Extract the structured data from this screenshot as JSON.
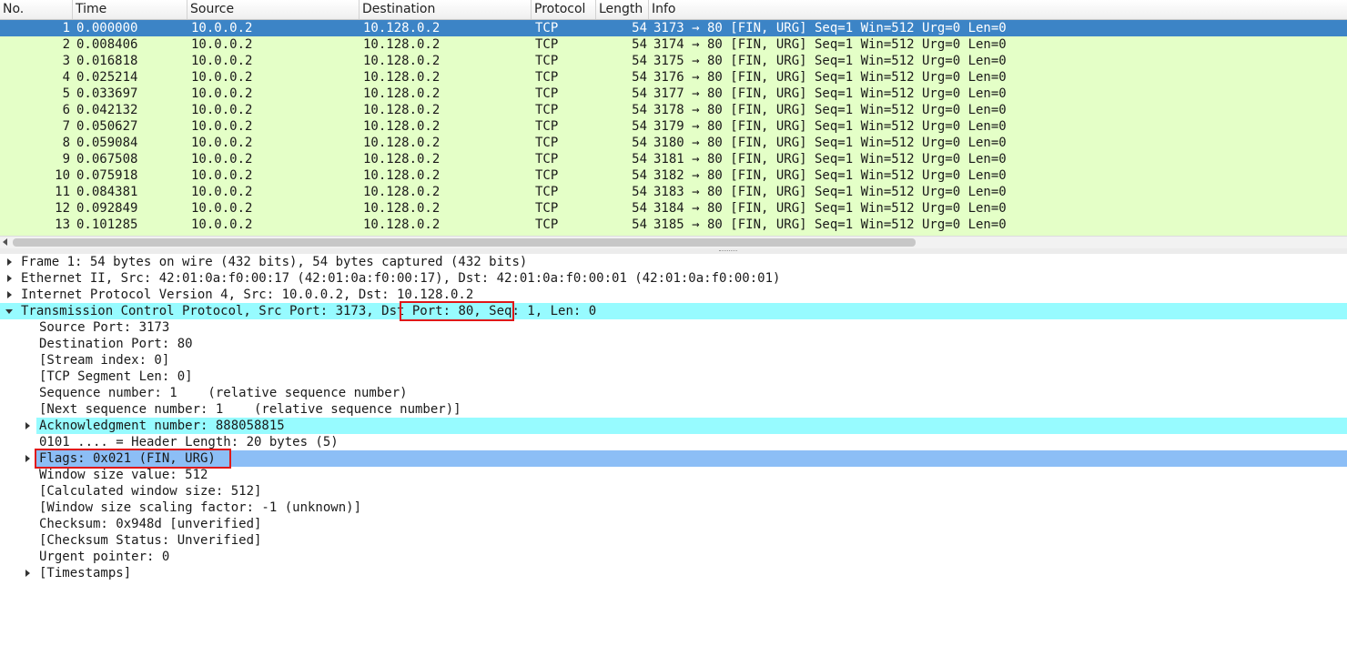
{
  "packet_list": {
    "columns": [
      "No.",
      "Time",
      "Source",
      "Destination",
      "Protocol",
      "Length",
      "Info"
    ],
    "rows": [
      {
        "no": "1",
        "time": "0.000000",
        "source": "10.0.0.2",
        "destination": "10.128.0.2",
        "protocol": "TCP",
        "length": "54",
        "info": "3173 → 80 [FIN, URG] Seq=1 Win=512 Urg=0 Len=0"
      },
      {
        "no": "2",
        "time": "0.008406",
        "source": "10.0.0.2",
        "destination": "10.128.0.2",
        "protocol": "TCP",
        "length": "54",
        "info": "3174 → 80 [FIN, URG] Seq=1 Win=512 Urg=0 Len=0"
      },
      {
        "no": "3",
        "time": "0.016818",
        "source": "10.0.0.2",
        "destination": "10.128.0.2",
        "protocol": "TCP",
        "length": "54",
        "info": "3175 → 80 [FIN, URG] Seq=1 Win=512 Urg=0 Len=0"
      },
      {
        "no": "4",
        "time": "0.025214",
        "source": "10.0.0.2",
        "destination": "10.128.0.2",
        "protocol": "TCP",
        "length": "54",
        "info": "3176 → 80 [FIN, URG] Seq=1 Win=512 Urg=0 Len=0"
      },
      {
        "no": "5",
        "time": "0.033697",
        "source": "10.0.0.2",
        "destination": "10.128.0.2",
        "protocol": "TCP",
        "length": "54",
        "info": "3177 → 80 [FIN, URG] Seq=1 Win=512 Urg=0 Len=0"
      },
      {
        "no": "6",
        "time": "0.042132",
        "source": "10.0.0.2",
        "destination": "10.128.0.2",
        "protocol": "TCP",
        "length": "54",
        "info": "3178 → 80 [FIN, URG] Seq=1 Win=512 Urg=0 Len=0"
      },
      {
        "no": "7",
        "time": "0.050627",
        "source": "10.0.0.2",
        "destination": "10.128.0.2",
        "protocol": "TCP",
        "length": "54",
        "info": "3179 → 80 [FIN, URG] Seq=1 Win=512 Urg=0 Len=0"
      },
      {
        "no": "8",
        "time": "0.059084",
        "source": "10.0.0.2",
        "destination": "10.128.0.2",
        "protocol": "TCP",
        "length": "54",
        "info": "3180 → 80 [FIN, URG] Seq=1 Win=512 Urg=0 Len=0"
      },
      {
        "no": "9",
        "time": "0.067508",
        "source": "10.0.0.2",
        "destination": "10.128.0.2",
        "protocol": "TCP",
        "length": "54",
        "info": "3181 → 80 [FIN, URG] Seq=1 Win=512 Urg=0 Len=0"
      },
      {
        "no": "10",
        "time": "0.075918",
        "source": "10.0.0.2",
        "destination": "10.128.0.2",
        "protocol": "TCP",
        "length": "54",
        "info": "3182 → 80 [FIN, URG] Seq=1 Win=512 Urg=0 Len=0"
      },
      {
        "no": "11",
        "time": "0.084381",
        "source": "10.0.0.2",
        "destination": "10.128.0.2",
        "protocol": "TCP",
        "length": "54",
        "info": "3183 → 80 [FIN, URG] Seq=1 Win=512 Urg=0 Len=0"
      },
      {
        "no": "12",
        "time": "0.092849",
        "source": "10.0.0.2",
        "destination": "10.128.0.2",
        "protocol": "TCP",
        "length": "54",
        "info": "3184 → 80 [FIN, URG] Seq=1 Win=512 Urg=0 Len=0"
      },
      {
        "no": "13",
        "time": "0.101285",
        "source": "10.0.0.2",
        "destination": "10.128.0.2",
        "protocol": "TCP",
        "length": "54",
        "info": "3185 → 80 [FIN, URG] Seq=1 Win=512 Urg=0 Len=0"
      }
    ],
    "colors": {
      "row_background": "#e4ffc7",
      "selected_background": "#3c84c6"
    }
  },
  "details": {
    "frame": "Frame 1: 54 bytes on wire (432 bits), 54 bytes captured (432 bits)",
    "ethernet": "Ethernet II, Src: 42:01:0a:f0:00:17 (42:01:0a:f0:00:17), Dst: 42:01:0a:f0:00:01 (42:01:0a:f0:00:01)",
    "ip": "Internet Protocol Version 4, Src: 10.0.0.2, Dst: 10.128.0.2",
    "tcp_prefix": "Transmission Control Protocol, Src Port: 3173, ",
    "tcp_dst": "Dst Port: 80,",
    "tcp_suffix": " Seq: 1, Len: 0",
    "source_port": "Source Port: 3173",
    "destination_port": "Destination Port: 80",
    "stream_index": "[Stream index: 0]",
    "segment_len": "[TCP Segment Len: 0]",
    "sequence_number": "Sequence number: 1    (relative sequence number)",
    "next_sequence": "[Next sequence number: 1    (relative sequence number)]",
    "ack_number": "Acknowledgment number: 888058815",
    "header_length": "0101 .... = Header Length: 20 bytes (5)",
    "flags": "Flags: 0x021 (FIN, URG)",
    "window_size": "Window size value: 512",
    "calc_window": "[Calculated window size: 512]",
    "scaling_factor": "[Window size scaling factor: -1 (unknown)]",
    "checksum": "Checksum: 0x948d [unverified]",
    "checksum_status": "[Checksum Status: Unverified]",
    "urgent_pointer": "Urgent pointer: 0",
    "timestamps": "[Timestamps]",
    "colors": {
      "highlight_cyan": "#97fbff",
      "highlight_blue": "#8cbef6",
      "annotation_red": "#e01818"
    }
  }
}
